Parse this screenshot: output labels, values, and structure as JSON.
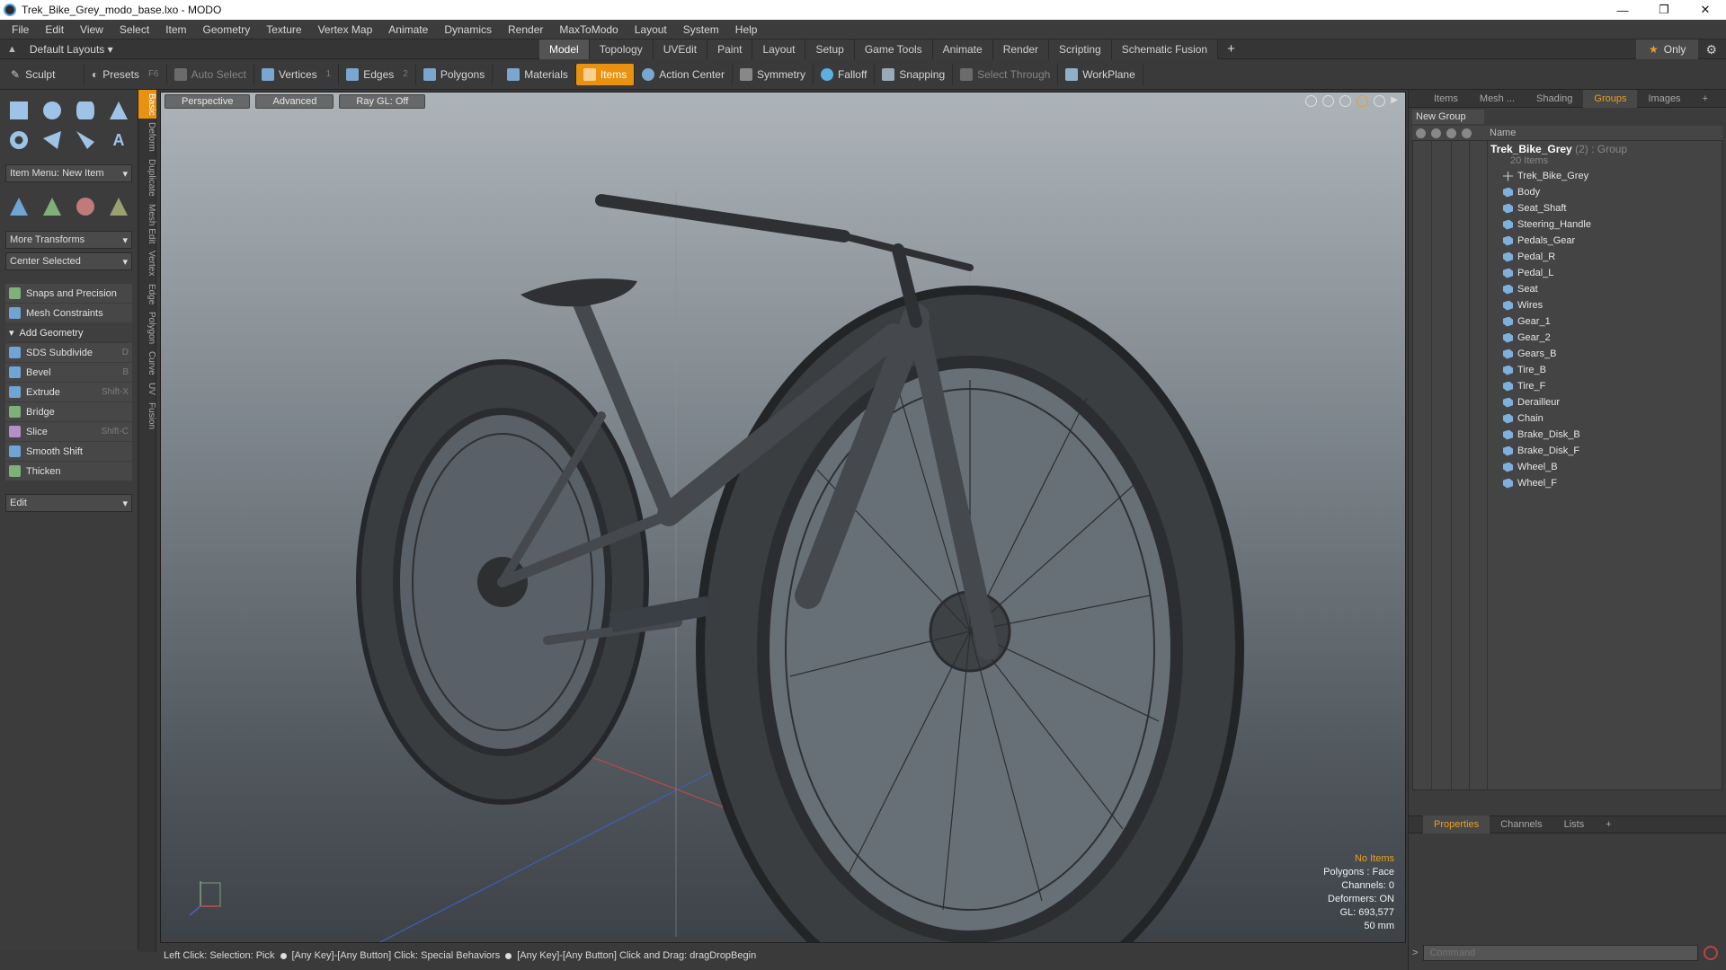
{
  "window": {
    "title": "Trek_Bike_Grey_modo_base.lxo - MODO",
    "minimize": "—",
    "maximize": "❐",
    "close": "✕"
  },
  "menu": [
    "File",
    "Edit",
    "View",
    "Select",
    "Item",
    "Geometry",
    "Texture",
    "Vertex Map",
    "Animate",
    "Dynamics",
    "Render",
    "MaxToModo",
    "Layout",
    "System",
    "Help"
  ],
  "layout": {
    "selector": "Default Layouts ▾",
    "tabs": [
      "Model",
      "Topology",
      "UVEdit",
      "Paint",
      "Layout",
      "Setup",
      "Game Tools",
      "Animate",
      "Render",
      "Scripting",
      "Schematic Fusion"
    ],
    "active_tab": "Model",
    "only_label": "Only"
  },
  "toolbar": {
    "sculpt": "Sculpt",
    "presets": "Presets",
    "presets_key": "F6",
    "auto_select": "Auto Select",
    "vertices": "Vertices",
    "vertices_key": "1",
    "edges": "Edges",
    "edges_key": "2",
    "polygons": "Polygons",
    "materials": "Materials",
    "items": "Items",
    "action_center": "Action Center",
    "symmetry": "Symmetry",
    "falloff": "Falloff",
    "snapping": "Snapping",
    "select_through": "Select Through",
    "workplane": "WorkPlane"
  },
  "left": {
    "item_menu": "Item Menu: New Item",
    "more_transforms": "More Transforms",
    "center_selected": "Center Selected",
    "snaps": "Snaps and Precision",
    "mesh_constraints": "Mesh Constraints",
    "add_geometry": "Add Geometry",
    "tools": [
      {
        "label": "SDS Subdivide",
        "key": "D"
      },
      {
        "label": "Bevel",
        "key": "B"
      },
      {
        "label": "Extrude",
        "key": "Shift-X"
      },
      {
        "label": "Bridge",
        "key": ""
      },
      {
        "label": "Slice",
        "key": "Shift-C"
      },
      {
        "label": "Smooth Shift",
        "key": ""
      },
      {
        "label": "Thicken",
        "key": ""
      }
    ],
    "edit": "Edit"
  },
  "vtabs": [
    "Basic",
    "Deform",
    "Duplicate",
    "Mesh Edit",
    "Vertex",
    "Edge",
    "Polygon",
    "Curve",
    "UV",
    "Fusion"
  ],
  "viewport": {
    "perspective": "Perspective",
    "advanced": "Advanced",
    "raygl": "Ray GL: Off",
    "hud": {
      "no_items": "No Items",
      "polygons": "Polygons : Face",
      "channels": "Channels: 0",
      "deformers": "Deformers: ON",
      "gl": "GL: 693,577",
      "lens": "50 mm"
    }
  },
  "status": {
    "part1": "Left Click: Selection: Pick",
    "part2": "[Any Key]-[Any Button] Click: Special Behaviors",
    "part3": "[Any Key]-[Any Button] Click and Drag: dragDropBegin"
  },
  "right": {
    "tabs": [
      "Items",
      "Mesh ...",
      "Shading",
      "Groups",
      "Images"
    ],
    "active_tab": "Groups",
    "new_group": "New Group",
    "name_col": "Name",
    "group": {
      "name": "Trek_Bike_Grey",
      "suffix": "(2) : Group",
      "count": "20 Items"
    },
    "items": [
      "Trek_Bike_Grey",
      "Body",
      "Seat_Shaft",
      "Steering_Handle",
      "Pedals_Gear",
      "Pedal_R",
      "Pedal_L",
      "Seat",
      "Wires",
      "Gear_1",
      "Gear_2",
      "Gears_B",
      "Tire_B",
      "Tire_F",
      "Derailleur",
      "Chain",
      "Brake_Disk_B",
      "Brake_Disk_F",
      "Wheel_B",
      "Wheel_F"
    ],
    "prop_tabs": [
      "Properties",
      "Channels",
      "Lists"
    ],
    "active_prop_tab": "Properties",
    "command_placeholder": "Command"
  }
}
